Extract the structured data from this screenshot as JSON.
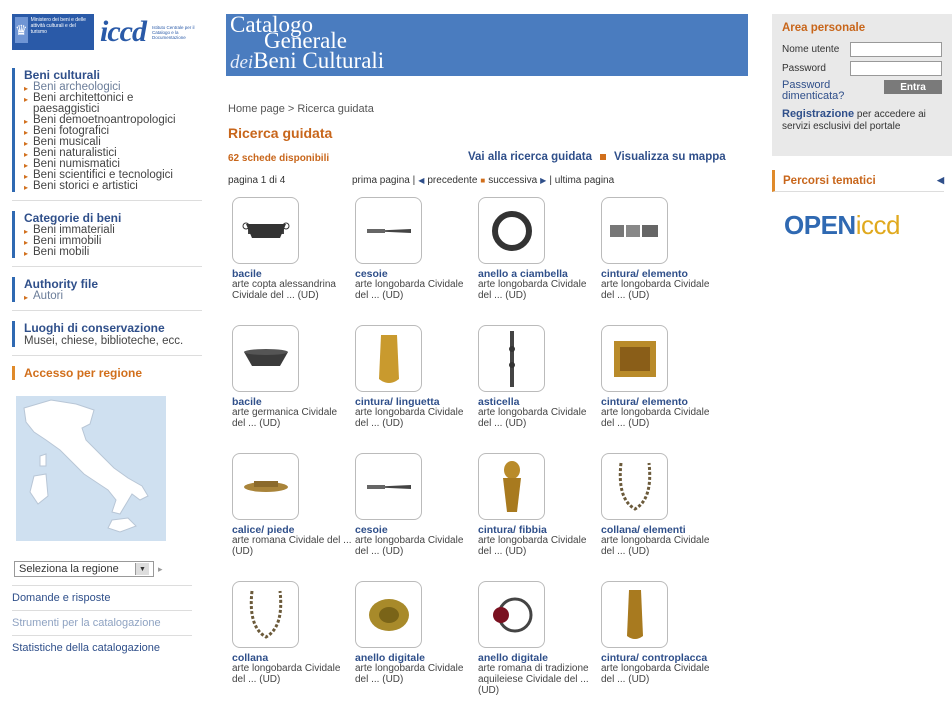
{
  "header": {
    "ministry_text": "Ministero dei beni e delle attività culturali e del turismo",
    "logo_text": "iccd",
    "logo_sub": "Istituto Centrale per il Catalogo e la Documentazione",
    "banner_line1": "Catalogo",
    "banner_line2": "Generale",
    "banner_line3_italic": "dei",
    "banner_line3": "Beni Culturali"
  },
  "sidebar": {
    "beni_culturali": {
      "title": "Beni culturali",
      "items": [
        "Beni archeologici",
        "Beni architettonici e paesaggistici",
        "Beni demoetnoantropologici",
        "Beni fotografici",
        "Beni musicali",
        "Beni naturalistici",
        "Beni numismatici",
        "Beni scientifici e tecnologici",
        "Beni storici e artistici"
      ]
    },
    "categorie": {
      "title": "Categorie di beni",
      "items": [
        "Beni immateriali",
        "Beni immobili",
        "Beni mobili"
      ]
    },
    "authority": {
      "title": "Authority file",
      "items": [
        "Autori"
      ]
    },
    "luoghi": {
      "title": "Luoghi di conservazione",
      "desc": "Musei, chiese, biblioteche, ecc."
    },
    "regione": {
      "title": "Accesso per regione",
      "select": "Seleziona la regione"
    },
    "links": [
      "Domande e risposte",
      "Strumenti per la catalogazione",
      "Statistiche della catalogazione"
    ]
  },
  "main": {
    "breadcrumb": "Home page > Ricerca guidata",
    "title": "Ricerca guidata",
    "count": "62 schede disponibili",
    "mode_guided": "Vai alla ricerca guidata",
    "mode_map": "Visualizza su mappa",
    "page_info": "pagina 1 di 4",
    "pager": {
      "first": "prima pagina |",
      "prev": "precedente",
      "next": "successiva",
      "last": "| ultima pagina"
    },
    "items": [
      {
        "title": "bacile",
        "sub": "arte copta alessandrina Cividale del ... (UD)",
        "icon": "basin-icon"
      },
      {
        "title": "cesoie",
        "sub": "arte longobarda Cividale del ... (UD)",
        "icon": "shears-icon"
      },
      {
        "title": "anello a ciambella",
        "sub": "arte longobarda Cividale del ... (UD)",
        "icon": "ring-icon"
      },
      {
        "title": "cintura/ elemento",
        "sub": "arte longobarda Cividale del ... (UD)",
        "icon": "belt-element-icon"
      },
      {
        "title": "bacile",
        "sub": "arte germanica Cividale del ... (UD)",
        "icon": "bowl-icon"
      },
      {
        "title": "cintura/ linguetta",
        "sub": "arte longobarda Cividale del ... (UD)",
        "icon": "belt-tongue-icon"
      },
      {
        "title": "asticella",
        "sub": "arte longobarda Cividale del ... (UD)",
        "icon": "rod-icon"
      },
      {
        "title": "cintura/ elemento",
        "sub": "arte longobarda Cividale del ... (UD)",
        "icon": "belt-plate-icon"
      },
      {
        "title": "calice/ piede",
        "sub": "arte romana Cividale del ... (UD)",
        "icon": "chalice-foot-icon"
      },
      {
        "title": "cesoie",
        "sub": "arte longobarda Cividale del ... (UD)",
        "icon": "shears-icon"
      },
      {
        "title": "cintura/ fibbia",
        "sub": "arte longobarda Cividale del ... (UD)",
        "icon": "buckle-icon"
      },
      {
        "title": "collana/ elementi",
        "sub": "arte longobarda Cividale del ... (UD)",
        "icon": "necklace-icon"
      },
      {
        "title": "collana",
        "sub": "arte longobarda Cividale del ... (UD)",
        "icon": "necklace-icon"
      },
      {
        "title": "anello digitale",
        "sub": "arte longobarda Cividale del ... (UD)",
        "icon": "gold-ring-icon"
      },
      {
        "title": "anello digitale",
        "sub": "arte romana di tradizione aquileiese Cividale del ... (UD)",
        "icon": "gem-ring-icon"
      },
      {
        "title": "cintura/ controplacca",
        "sub": "arte longobarda Cividale del ... (UD)",
        "icon": "counterplate-icon"
      }
    ]
  },
  "right": {
    "area_title": "Area personale",
    "user_label": "Nome utente",
    "pass_label": "Password",
    "forgot": "Password dimenticata?",
    "enter": "Entra",
    "reg_bold": "Registrazione",
    "reg_text": "per accedere ai servizi esclusivi del portale",
    "percorsi": "Percorsi tematici",
    "open_a": "OPEN",
    "open_b": "iccd"
  },
  "colors": {
    "accent_orange": "#c8661b",
    "link_blue": "#2f4f8a",
    "banner_blue": "#4a7cbf"
  }
}
